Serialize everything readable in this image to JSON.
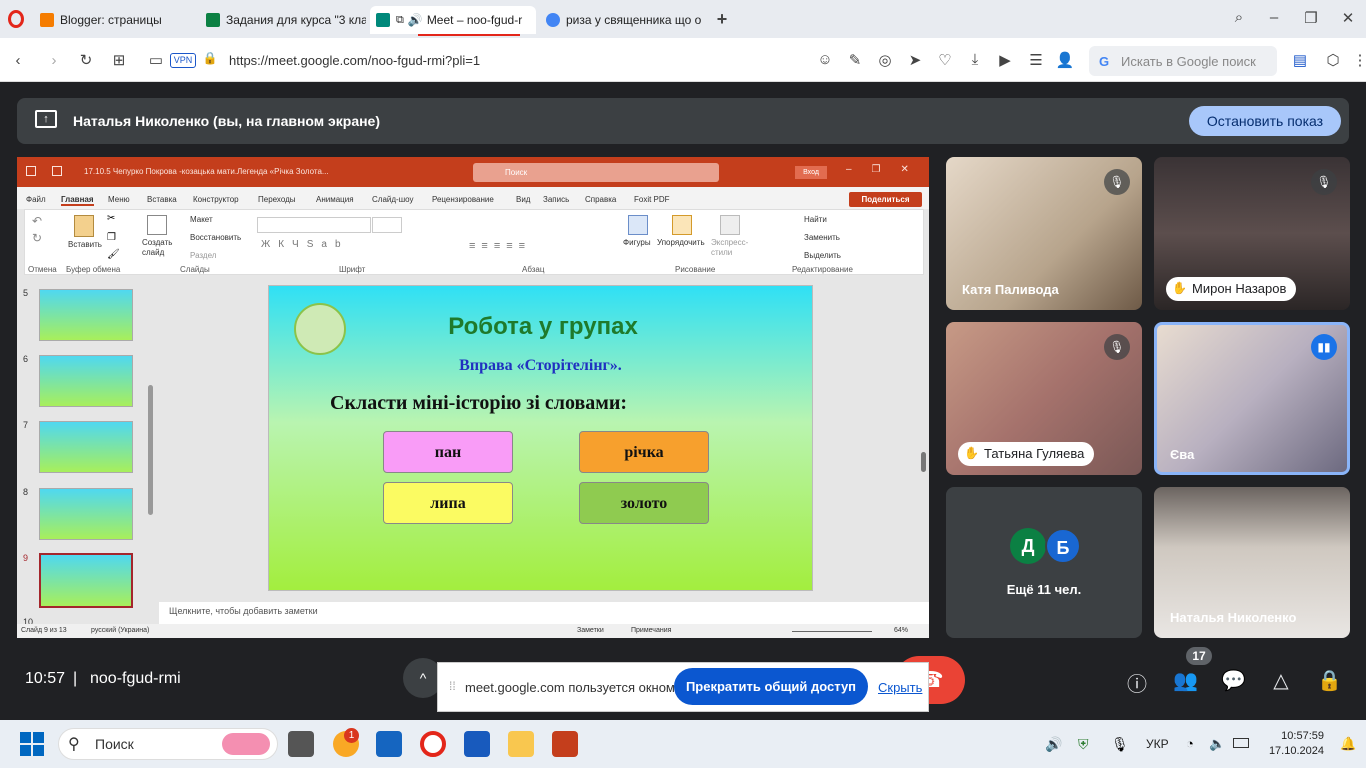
{
  "browser": {
    "tabs": [
      {
        "label": "Blogger: страницы",
        "color": "#f57c00"
      },
      {
        "label": "Задания для курса \"3 кла",
        "color": "#0b8043"
      },
      {
        "label": "Meet – noo-fgud-r",
        "color": "#00897b"
      },
      {
        "label": "риза у священника що о",
        "color": "#4285f4"
      }
    ],
    "vpn_label": "VPN",
    "url": "https://meet.google.com/noo-fgud-rmi?pli=1",
    "search_placeholder": "Искать в Google поиск"
  },
  "presentation": {
    "presenter_text": "Наталья Николенко (вы, на главном экране)",
    "stop_button": "Остановить показ"
  },
  "powerpoint": {
    "title": "17.10.5 Чепурко Покрова -козацька мати.Легенда «Річка Золота...",
    "search_placeholder": "Поиск",
    "login": "Вход",
    "tabs": [
      "Файл",
      "Главная",
      "Меню",
      "Вставка",
      "Конструктор",
      "Переходы",
      "Анимация",
      "Слайд-шоу",
      "Рецензирование",
      "Вид",
      "Запись",
      "Справка",
      "Foxit PDF"
    ],
    "share_button": "Поделиться",
    "ribbon": {
      "paste": "Вставить",
      "new_slide": "Создать слайд",
      "layout": "Макет",
      "reset": "Восстановить",
      "section": "Раздел",
      "shapes": "Фигуры",
      "arrange": "Упорядочить",
      "styles": "Экспресс-стили",
      "find": "Найти",
      "replace": "Заменить",
      "select": "Выделить",
      "groups": [
        "Отмена",
        "Буфер обмена",
        "Слайды",
        "Шрифт",
        "Абзац",
        "Рисование",
        "Редактирование"
      ]
    },
    "thumb_numbers": [
      "5",
      "6",
      "7",
      "8",
      "9",
      "10"
    ],
    "slide": {
      "title": "Робота у групах",
      "subtitle": "Вправа «Сторітелінг».",
      "task": "Скласти міні-історію зі словами:",
      "words": [
        {
          "text": "пан",
          "color": "#f99cf7"
        },
        {
          "text": "річка",
          "color": "#f7a02d"
        },
        {
          "text": "липа",
          "color": "#fbfb62"
        },
        {
          "text": "золото",
          "color": "#8fcb50"
        }
      ]
    },
    "notes_placeholder": "Щелкните, чтобы добавить заметки",
    "status": {
      "slide": "Слайд 9 из 13",
      "language": "русский (Украина)",
      "notes": "Заметки",
      "comments": "Примечания",
      "zoom": "64%"
    }
  },
  "participants": [
    {
      "name": "Катя Паливода",
      "muted": true
    },
    {
      "name": "Мирон Назаров",
      "muted": true,
      "hand": true
    },
    {
      "name": "Татьяна Гуляева",
      "muted": true,
      "hand": true
    },
    {
      "name": "Єва",
      "speaking": true
    },
    {
      "name": "Наталья Николенко"
    }
  ],
  "more": {
    "text": "Ещё 11 чел.",
    "avatars": [
      "Д",
      "Б"
    ]
  },
  "bottom": {
    "time": "10:57",
    "separator": "|",
    "meeting_code": "noo-fgud-rmi",
    "share_notice": "meet.google.com пользуется окном.",
    "stop_share": "Прекратить общий доступ",
    "hide": "Скрыть",
    "participants_count": "17"
  },
  "taskbar": {
    "search": "Поиск",
    "notification_count": "1",
    "language": "УКР",
    "time": "10:57:59",
    "date": "17.10.2024"
  }
}
